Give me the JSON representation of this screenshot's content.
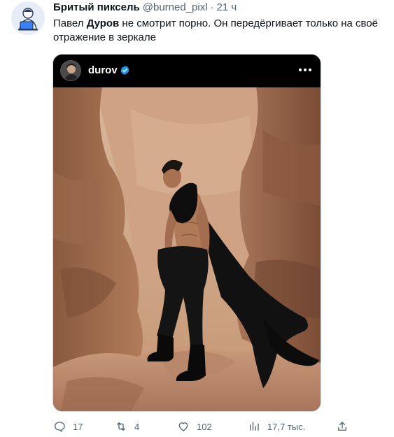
{
  "tweet": {
    "author": {
      "display_name": "Бритый пиксель",
      "handle": "@burned_pixl",
      "time": "21 ч"
    },
    "text_before": "Павел ",
    "text_bold": "Дуров",
    "text_after": " не смотрит порно. Он передёргивает только на своё отражение в зеркале",
    "card": {
      "username": "durov",
      "verified_icon": "verified-badge-icon",
      "more_icon": "more-icon"
    },
    "actions": {
      "replies": "17",
      "retweets": "4",
      "likes": "102",
      "views": "17,7 тыс."
    }
  },
  "colors": {
    "text": "#0f1419",
    "muted": "#536471",
    "verified": "#1d9bf0"
  }
}
